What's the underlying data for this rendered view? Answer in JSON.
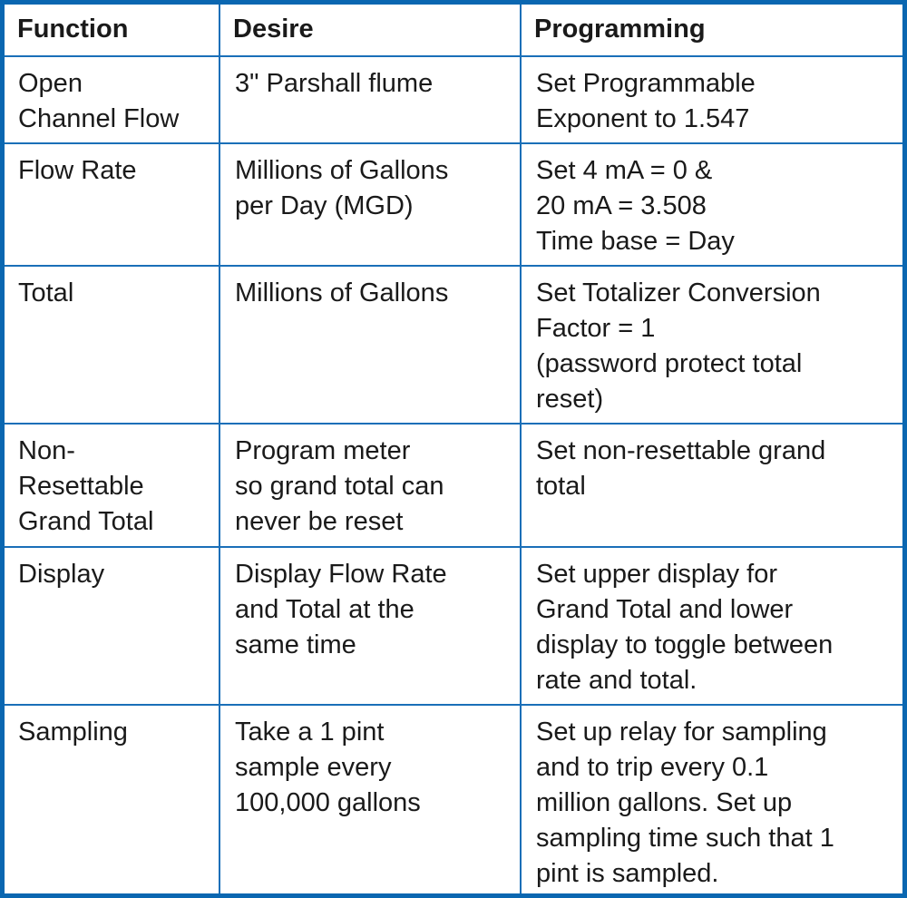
{
  "table": {
    "headers": [
      "Function",
      "Desire",
      "Programming"
    ],
    "rows": [
      {
        "function": "Open\nChannel Flow",
        "desire": "3\" Parshall flume",
        "programming": "Set Programmable\nExponent to 1.547"
      },
      {
        "function": "Flow Rate",
        "desire": "Millions of Gallons\nper Day (MGD)",
        "programming": "Set 4 mA = 0 &\n20 mA = 3.508\nTime base = Day"
      },
      {
        "function": "Total",
        "desire": "Millions of Gallons",
        "programming": "Set Totalizer Conversion\nFactor = 1\n(password protect total\nreset)"
      },
      {
        "function": "Non-\nResettable\nGrand Total",
        "desire": "Program meter\nso grand total can\nnever be reset",
        "programming": "Set non-resettable grand\ntotal"
      },
      {
        "function": "Display",
        "desire": "Display Flow Rate\nand Total at the\nsame time",
        "programming": "Set upper display for\nGrand Total and lower\ndisplay to toggle between\nrate and total."
      },
      {
        "function": "Sampling",
        "desire": "Take a 1 pint\nsample every\n100,000 gallons",
        "programming": "Set up relay for sampling\nand to trip every 0.1\nmillion gallons. Set up\nsampling time such that 1\npint is sampled."
      }
    ]
  },
  "colors": {
    "border": "#0a67b1",
    "text": "#1a1a1a",
    "background": "#ffffff"
  }
}
